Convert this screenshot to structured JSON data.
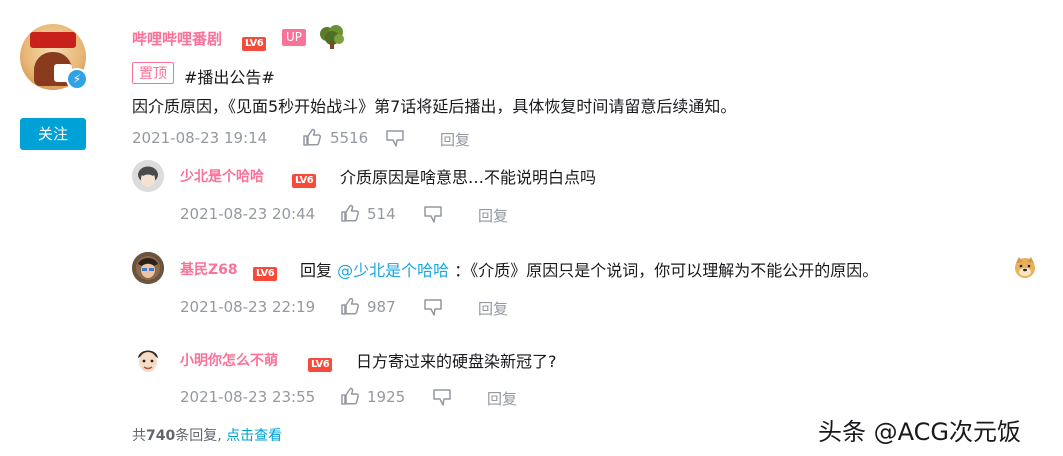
{
  "main": {
    "uname": "哔哩哔哩番剧",
    "level": "LV6",
    "up_tag": "UP",
    "follow_label": "关注",
    "pin_tag": "置顶",
    "topic": "#播出公告#",
    "content": "因介质原因，《见面5秒开始战斗》第7话将延后播出，具体恢复时间请留意后续通知。",
    "time": "2021-08-23 19:14",
    "likes": "5516",
    "reply_label": "回复"
  },
  "replies": [
    {
      "uname": "少北是个哈哈",
      "level": "LV6",
      "content": "介质原因是啥意思…不能说明白点吗",
      "time": "2021-08-23 20:44",
      "likes": "514",
      "reply_label": "回复"
    },
    {
      "uname": "基民Z68",
      "level": "LV6",
      "reply_prefix": "回复",
      "mention": "@少北是个哈哈",
      "content": "：《介质》原因只是个说词，你可以理解为不能公开的原因。",
      "time": "2021-08-23 22:19",
      "likes": "987",
      "reply_label": "回复"
    },
    {
      "uname": "小明你怎么不萌",
      "level": "LV6",
      "content": "日方寄过来的硬盘染新冠了?",
      "time": "2021-08-23 23:55",
      "likes": "1925",
      "reply_label": "回复"
    }
  ],
  "footer": {
    "prefix": "共",
    "count": "740",
    "suffix": "条回复,",
    "link": "点击查看"
  },
  "watermark": "头条 @ACG次元饭",
  "colors": {
    "accent_pink": "#fb7299",
    "link_blue": "#00a1d6",
    "level_red": "#f64a3a",
    "meta_gray": "#9499a0"
  }
}
